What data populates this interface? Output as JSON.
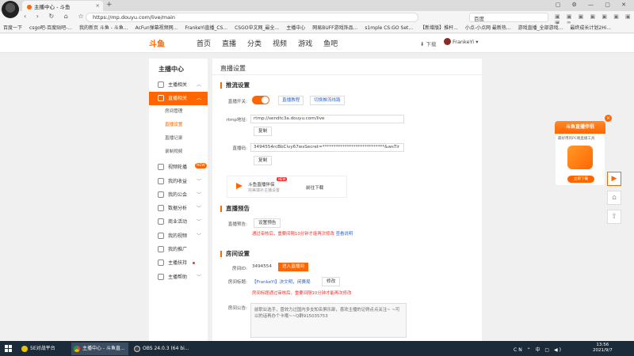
{
  "browser": {
    "tab_title": "主播中心 - 斗鱼",
    "url": "https://mp.douyu.com/live/main",
    "search_engine": "百度",
    "bookmarks": [
      "百度一下",
      "csgo吧-百度贴吧-...",
      "我的新页 斗鱼 - 斗鱼...",
      "AcFun弹幕视频网...",
      "FrankeYi直播_CS...",
      "CSGO中文网_最全...",
      "主播中心",
      "网易BUFF游戏饰品...",
      "s1mple CS:GO Set...",
      "【新增版】推杆...",
      "小点-小点网 最新热...",
      "游戏直播_全部游戏...",
      "最终成长计划2Hi..."
    ]
  },
  "site": {
    "logo": "斗鱼",
    "nav": [
      "首页",
      "直播",
      "分类",
      "视频",
      "游戏",
      "鱼吧"
    ],
    "download": "下载",
    "username": "FrankeYi"
  },
  "sidebar": {
    "title": "主播中心",
    "items": [
      {
        "label": "主播相关"
      },
      {
        "label": "直播相关"
      },
      {
        "label": "房间管理"
      },
      {
        "label": "直播设置"
      },
      {
        "label": "直播记录"
      },
      {
        "label": "录制视频"
      },
      {
        "label": "视频轮播",
        "tag": "NEW"
      },
      {
        "label": "我的收益"
      },
      {
        "label": "我的公会"
      },
      {
        "label": "数据分析"
      },
      {
        "label": "商业活动"
      },
      {
        "label": "我的视频"
      },
      {
        "label": "我的推广"
      },
      {
        "label": "主播扶持"
      },
      {
        "label": "主播帮助"
      }
    ]
  },
  "main": {
    "title": "直播设置",
    "stream": {
      "heading": "推流设置",
      "switch_label": "直播开关:",
      "stream_tutorial": "直播教程",
      "switch_line": "切换推流线路",
      "rtmp_label": "rtmp地址:",
      "rtmp_value": "rtmp://sendtc3a.douyu.com/live",
      "copy": "复制",
      "code_label": "直播码:",
      "code_value": "3494554rcBbCivy67wsSecret=****************************&wsTir",
      "promo_title": "斗鱼直播伴侣",
      "promo_new": "NEW",
      "promo_sub": "完美填补主播设置",
      "promo_download": "前往下载"
    },
    "notice": {
      "heading": "直播预告",
      "label": "直播预告:",
      "button": "设置预告",
      "hint": "通过审核后，重要间隔10分钟才能再次修改",
      "link": "查看说明"
    },
    "room": {
      "heading": "房间设置",
      "id_label": "房间ID:",
      "id_value": "3494554",
      "enter": "进入直播间",
      "title_label": "房间标题:",
      "title_value": "【FrankeYi】决文明，闲赛局",
      "modify": "修改",
      "title_hint": "房间标题通过审核后，重要间隔10分钟才能再次修改",
      "ann_label": "房间公告:",
      "ann_value": "前职业选手，曾效力过国内多支知名俱乐部，喜欢主播的记得点点关注~ ~可以的话再办个卡哦~~Q群915035753"
    }
  },
  "ad": {
    "title": "斗鱼直播伴侣",
    "sub": "最好用的PC端直播工具",
    "button": "立即下载"
  },
  "taskbar": {
    "items": [
      "5E对战平台",
      "主播中心 - 斗鱼直...",
      "OBS 24.0.3 (64 bi..."
    ],
    "tray": "CN ⌃ 中 ▢ ◀)",
    "time": "13:56",
    "date": "2021/9/7"
  }
}
